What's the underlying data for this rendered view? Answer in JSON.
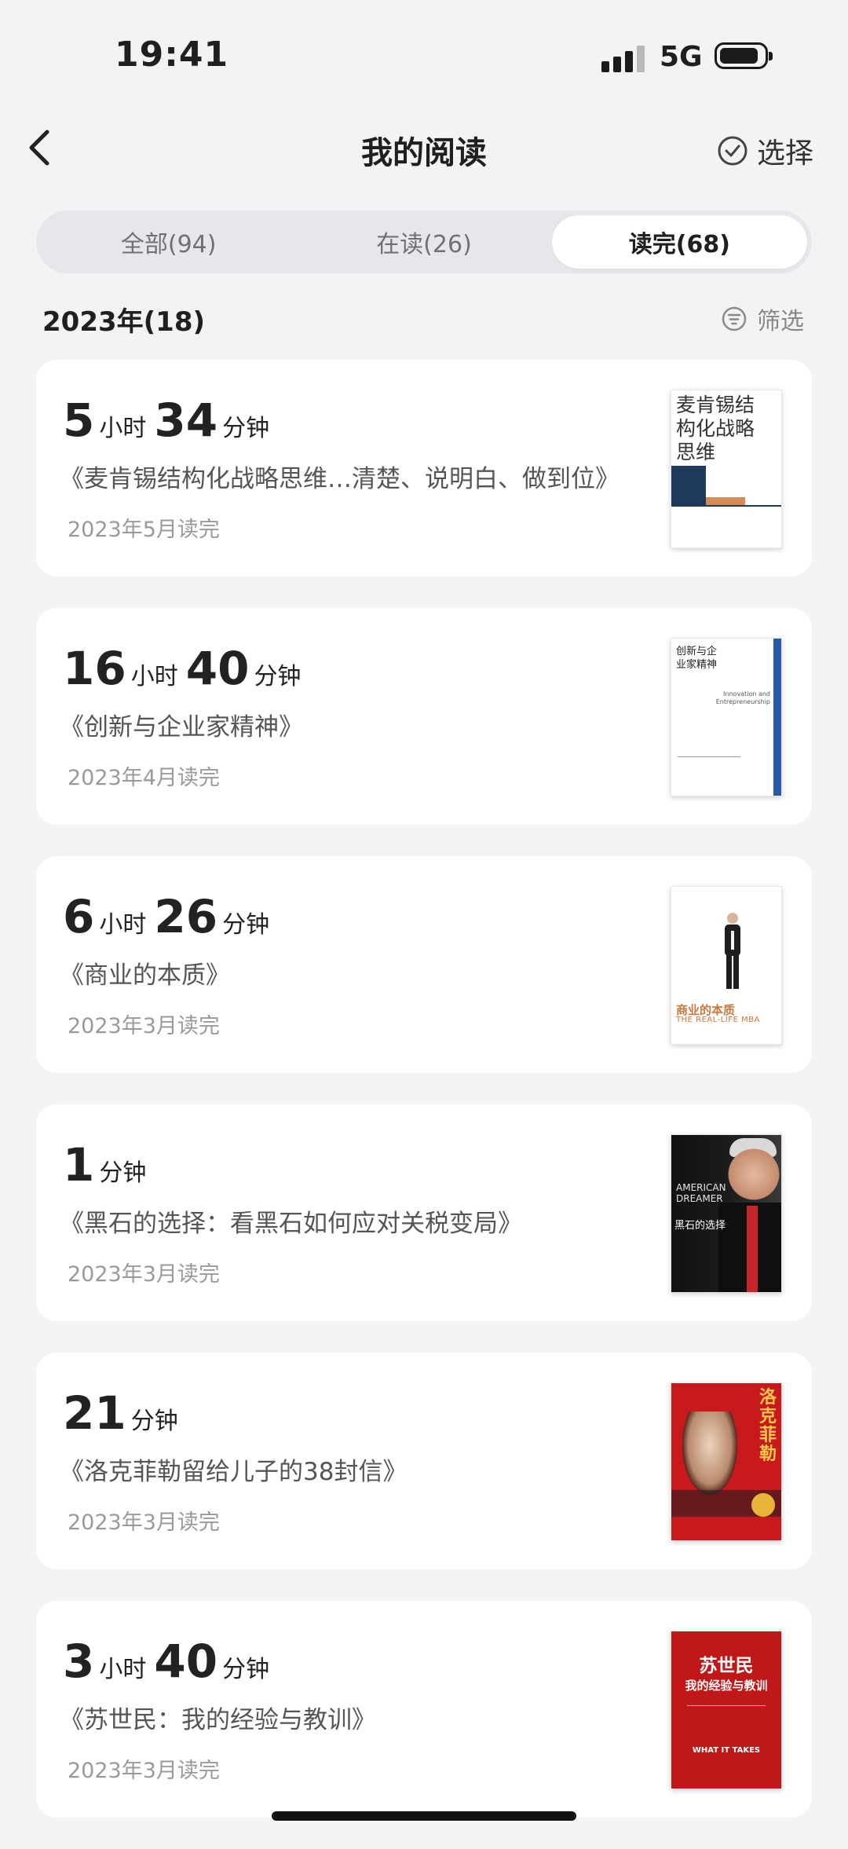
{
  "status_bar": {
    "time": "19:41",
    "network": "5G"
  },
  "nav": {
    "title": "我的阅读",
    "select_label": "选择"
  },
  "tabs": [
    {
      "label": "全部(94)",
      "active": false
    },
    {
      "label": "在读(26)",
      "active": false
    },
    {
      "label": "读完(68)",
      "active": true
    }
  ],
  "section": {
    "year_label": "2023年(18)",
    "filter_label": "筛选"
  },
  "books": [
    {
      "hours": "5",
      "hour_unit": "小时",
      "minutes": "34",
      "minute_unit": "分钟",
      "title": "《麦肯锡结构化战略思维…清楚、说明白、做到位》",
      "date": "2023年5月读完",
      "cover_text": "麦肯锡结构化战略思维"
    },
    {
      "hours": "16",
      "hour_unit": "小时",
      "minutes": "40",
      "minute_unit": "分钟",
      "title": "《创新与企业家精神》",
      "date": "2023年4月读完",
      "cover_text": "创新与企业家精神",
      "cover_subtext": "Innovation and Entrepreneurship"
    },
    {
      "hours": "6",
      "hour_unit": "小时",
      "minutes": "26",
      "minute_unit": "分钟",
      "title": "《商业的本质》",
      "date": "2023年3月读完",
      "cover_text": "商业的本质",
      "cover_subtext": "THE REAL-LIFE MBA"
    },
    {
      "minutes": "1",
      "minute_unit": "分钟",
      "title": "《黑石的选择：看黑石如何应对关税变局》",
      "date": "2023年3月读完",
      "cover_text": "黑石的选择",
      "cover_subtext": "AMERICAN DREAMER"
    },
    {
      "minutes": "21",
      "minute_unit": "分钟",
      "title": "《洛克菲勒留给儿子的38封信》",
      "date": "2023年3月读完",
      "cover_text": "洛克菲勒"
    },
    {
      "hours": "3",
      "hour_unit": "小时",
      "minutes": "40",
      "minute_unit": "分钟",
      "title": "《苏世民：我的经验与教训》",
      "date": "2023年3月读完",
      "cover_text": "苏世民",
      "cover_subtext": "我的经验与教训",
      "cover_footer": "WHAT IT TAKES"
    }
  ]
}
